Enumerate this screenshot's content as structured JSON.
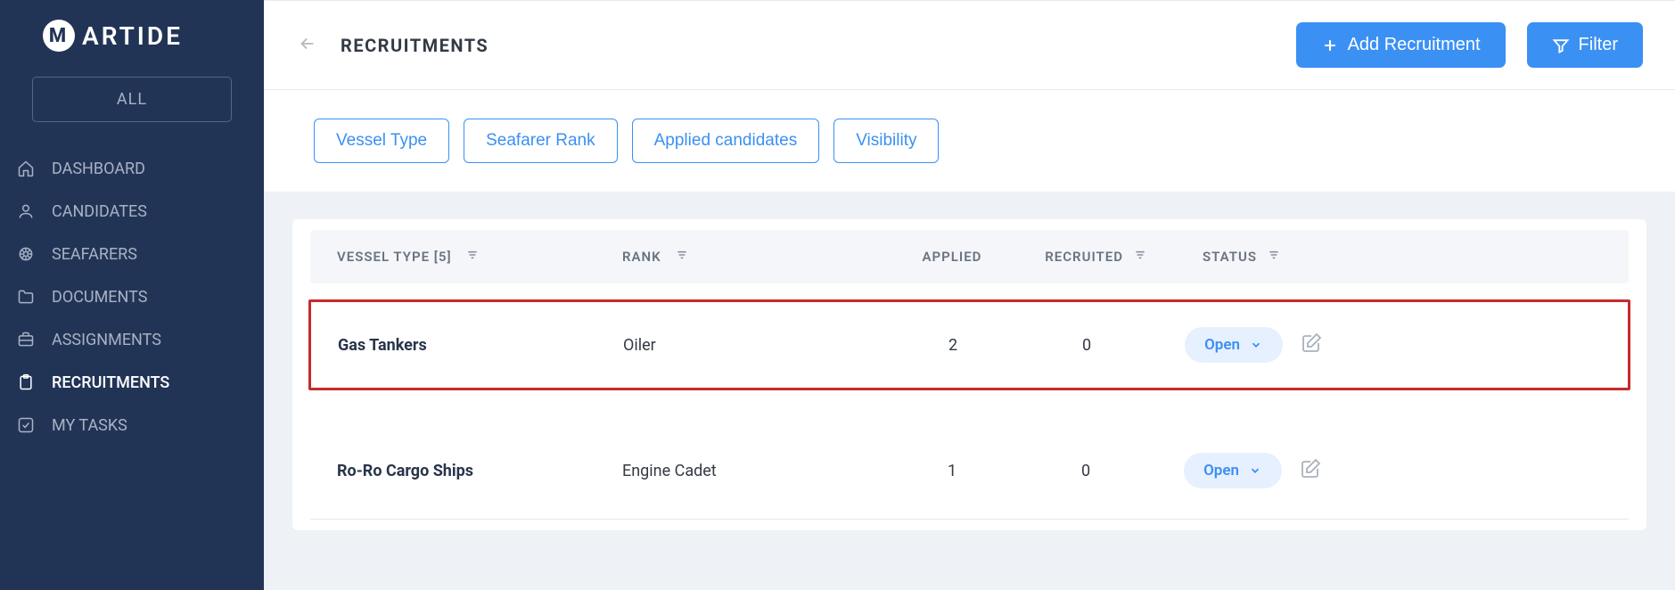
{
  "brand": {
    "name": "ARTIDE",
    "mark": "M"
  },
  "sidebar": {
    "select_label": "ALL",
    "items": [
      {
        "label": "DASHBOARD",
        "icon": "home-icon"
      },
      {
        "label": "CANDIDATES",
        "icon": "user-icon"
      },
      {
        "label": "SEAFARERS",
        "icon": "wheel-icon"
      },
      {
        "label": "DOCUMENTS",
        "icon": "folder-icon"
      },
      {
        "label": "ASSIGNMENTS",
        "icon": "briefcase-icon"
      },
      {
        "label": "RECRUITMENTS",
        "icon": "clipboard-icon",
        "active": true
      },
      {
        "label": "MY TASKS",
        "icon": "check-icon"
      }
    ]
  },
  "header": {
    "title": "RECRUITMENTS",
    "add_label": "Add Recruitment",
    "filter_label": "Filter"
  },
  "chips": [
    "Vessel Type",
    "Seafarer Rank",
    "Applied candidates",
    "Visibility"
  ],
  "table": {
    "columns": {
      "vessel": "VESSEL TYPE [5]",
      "rank": "RANK",
      "applied": "APPLIED",
      "recruited": "RECRUITED",
      "status": "STATUS"
    },
    "rows": [
      {
        "vessel": "Gas Tankers",
        "rank": "Oiler",
        "applied": "2",
        "recruited": "0",
        "status": "Open",
        "highlight": true
      },
      {
        "vessel": "Ro-Ro Cargo Ships",
        "rank": "Engine Cadet",
        "applied": "1",
        "recruited": "0",
        "status": "Open",
        "highlight": false
      }
    ]
  }
}
